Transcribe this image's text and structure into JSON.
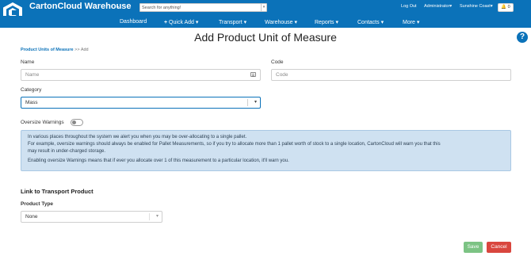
{
  "app": {
    "title": "CartonCloud Warehouse",
    "title_caret": "▾"
  },
  "search": {
    "placeholder": "Search for anything!",
    "dropdown": "▾"
  },
  "top_right": {
    "logout": "Log Out",
    "admin": "Administrator",
    "location": "Sunshine Coast",
    "bell": "🔔 0"
  },
  "nav": {
    "dashboard": "Dashboard",
    "quick_add": "Quick Add",
    "transport": "Transport",
    "warehouse": "Warehouse",
    "reports": "Reports",
    "contacts": "Contacts",
    "more": "More",
    "caret": "▾",
    "plus": "+"
  },
  "page": {
    "title": "Add Product Unit of Measure",
    "help": "?"
  },
  "breadcrumb": {
    "parent": "Product Units of Measure",
    "separator": ">>",
    "current": "Add"
  },
  "form": {
    "name_label": "Name",
    "name_placeholder": "Name",
    "code_label": "Code",
    "code_placeholder": "Code",
    "category_label": "Category",
    "category_value": "Mass",
    "oversize_label": "Oversize Warnings"
  },
  "info": {
    "line1": "In various places throughout the system we alert you when you may be over-allocating to a single pallet.",
    "line2": "For example, oversize warnings should always be enabled for Pallet Measurements, so if you try to allocate more than 1 pallet worth of stock to a single location, CartonCloud will warn you that this",
    "line3": "may result in under-charged storage.",
    "line4": "Enabling oversize Warnings means that if ever you allocate over 1 of this measurement to a particular location, it'll warn you."
  },
  "transport": {
    "section_title": "Link to Transport Product",
    "product_type_label": "Product Type",
    "product_type_value": "None"
  },
  "buttons": {
    "save": "Save",
    "cancel": "Cancel"
  },
  "colors": {
    "brand_blue": "#0b72b9",
    "info_bg": "#cfe1f1",
    "save_green": "#7cc384",
    "cancel_red": "#d9463e"
  },
  "icons": {
    "logo": "cartoncloud-logo-icon",
    "help": "help-circle-icon",
    "bell": "bell-icon",
    "name_field": "id-card-icon",
    "chevron": "chevron-down-icon"
  }
}
